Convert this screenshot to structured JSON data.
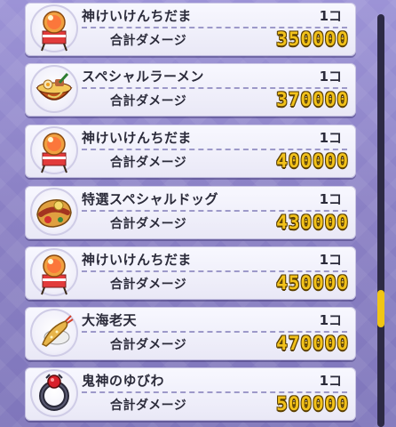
{
  "items": [
    {
      "name": "神けいけんちだま",
      "qty": "1コ",
      "damage_label": "合計ダメージ",
      "damage": "350000",
      "icon": "divine-exp-orb-icon"
    },
    {
      "name": "スペシャルラーメン",
      "qty": "1コ",
      "damage_label": "合計ダメージ",
      "damage": "370000",
      "icon": "ramen-bowl-icon"
    },
    {
      "name": "神けいけんちだま",
      "qty": "1コ",
      "damage_label": "合計ダメージ",
      "damage": "400000",
      "icon": "divine-exp-orb-icon"
    },
    {
      "name": "特選スペシャルドッグ",
      "qty": "1コ",
      "damage_label": "合計ダメージ",
      "damage": "430000",
      "icon": "hot-dog-icon"
    },
    {
      "name": "神けいけんちだま",
      "qty": "1コ",
      "damage_label": "合計ダメージ",
      "damage": "450000",
      "icon": "divine-exp-orb-icon"
    },
    {
      "name": "大海老天",
      "qty": "1コ",
      "damage_label": "合計ダメージ",
      "damage": "470000",
      "icon": "shrimp-tempura-icon"
    },
    {
      "name": "鬼神のゆびわ",
      "qty": "1コ",
      "damage_label": "合計ダメージ",
      "damage": "500000",
      "icon": "oni-ring-icon"
    }
  ],
  "colors": {
    "damage_gold": "#f2c21b",
    "scroll_thumb": "#f1c514",
    "background": "#8f86c8"
  },
  "scroll": {
    "position": 0.7
  }
}
